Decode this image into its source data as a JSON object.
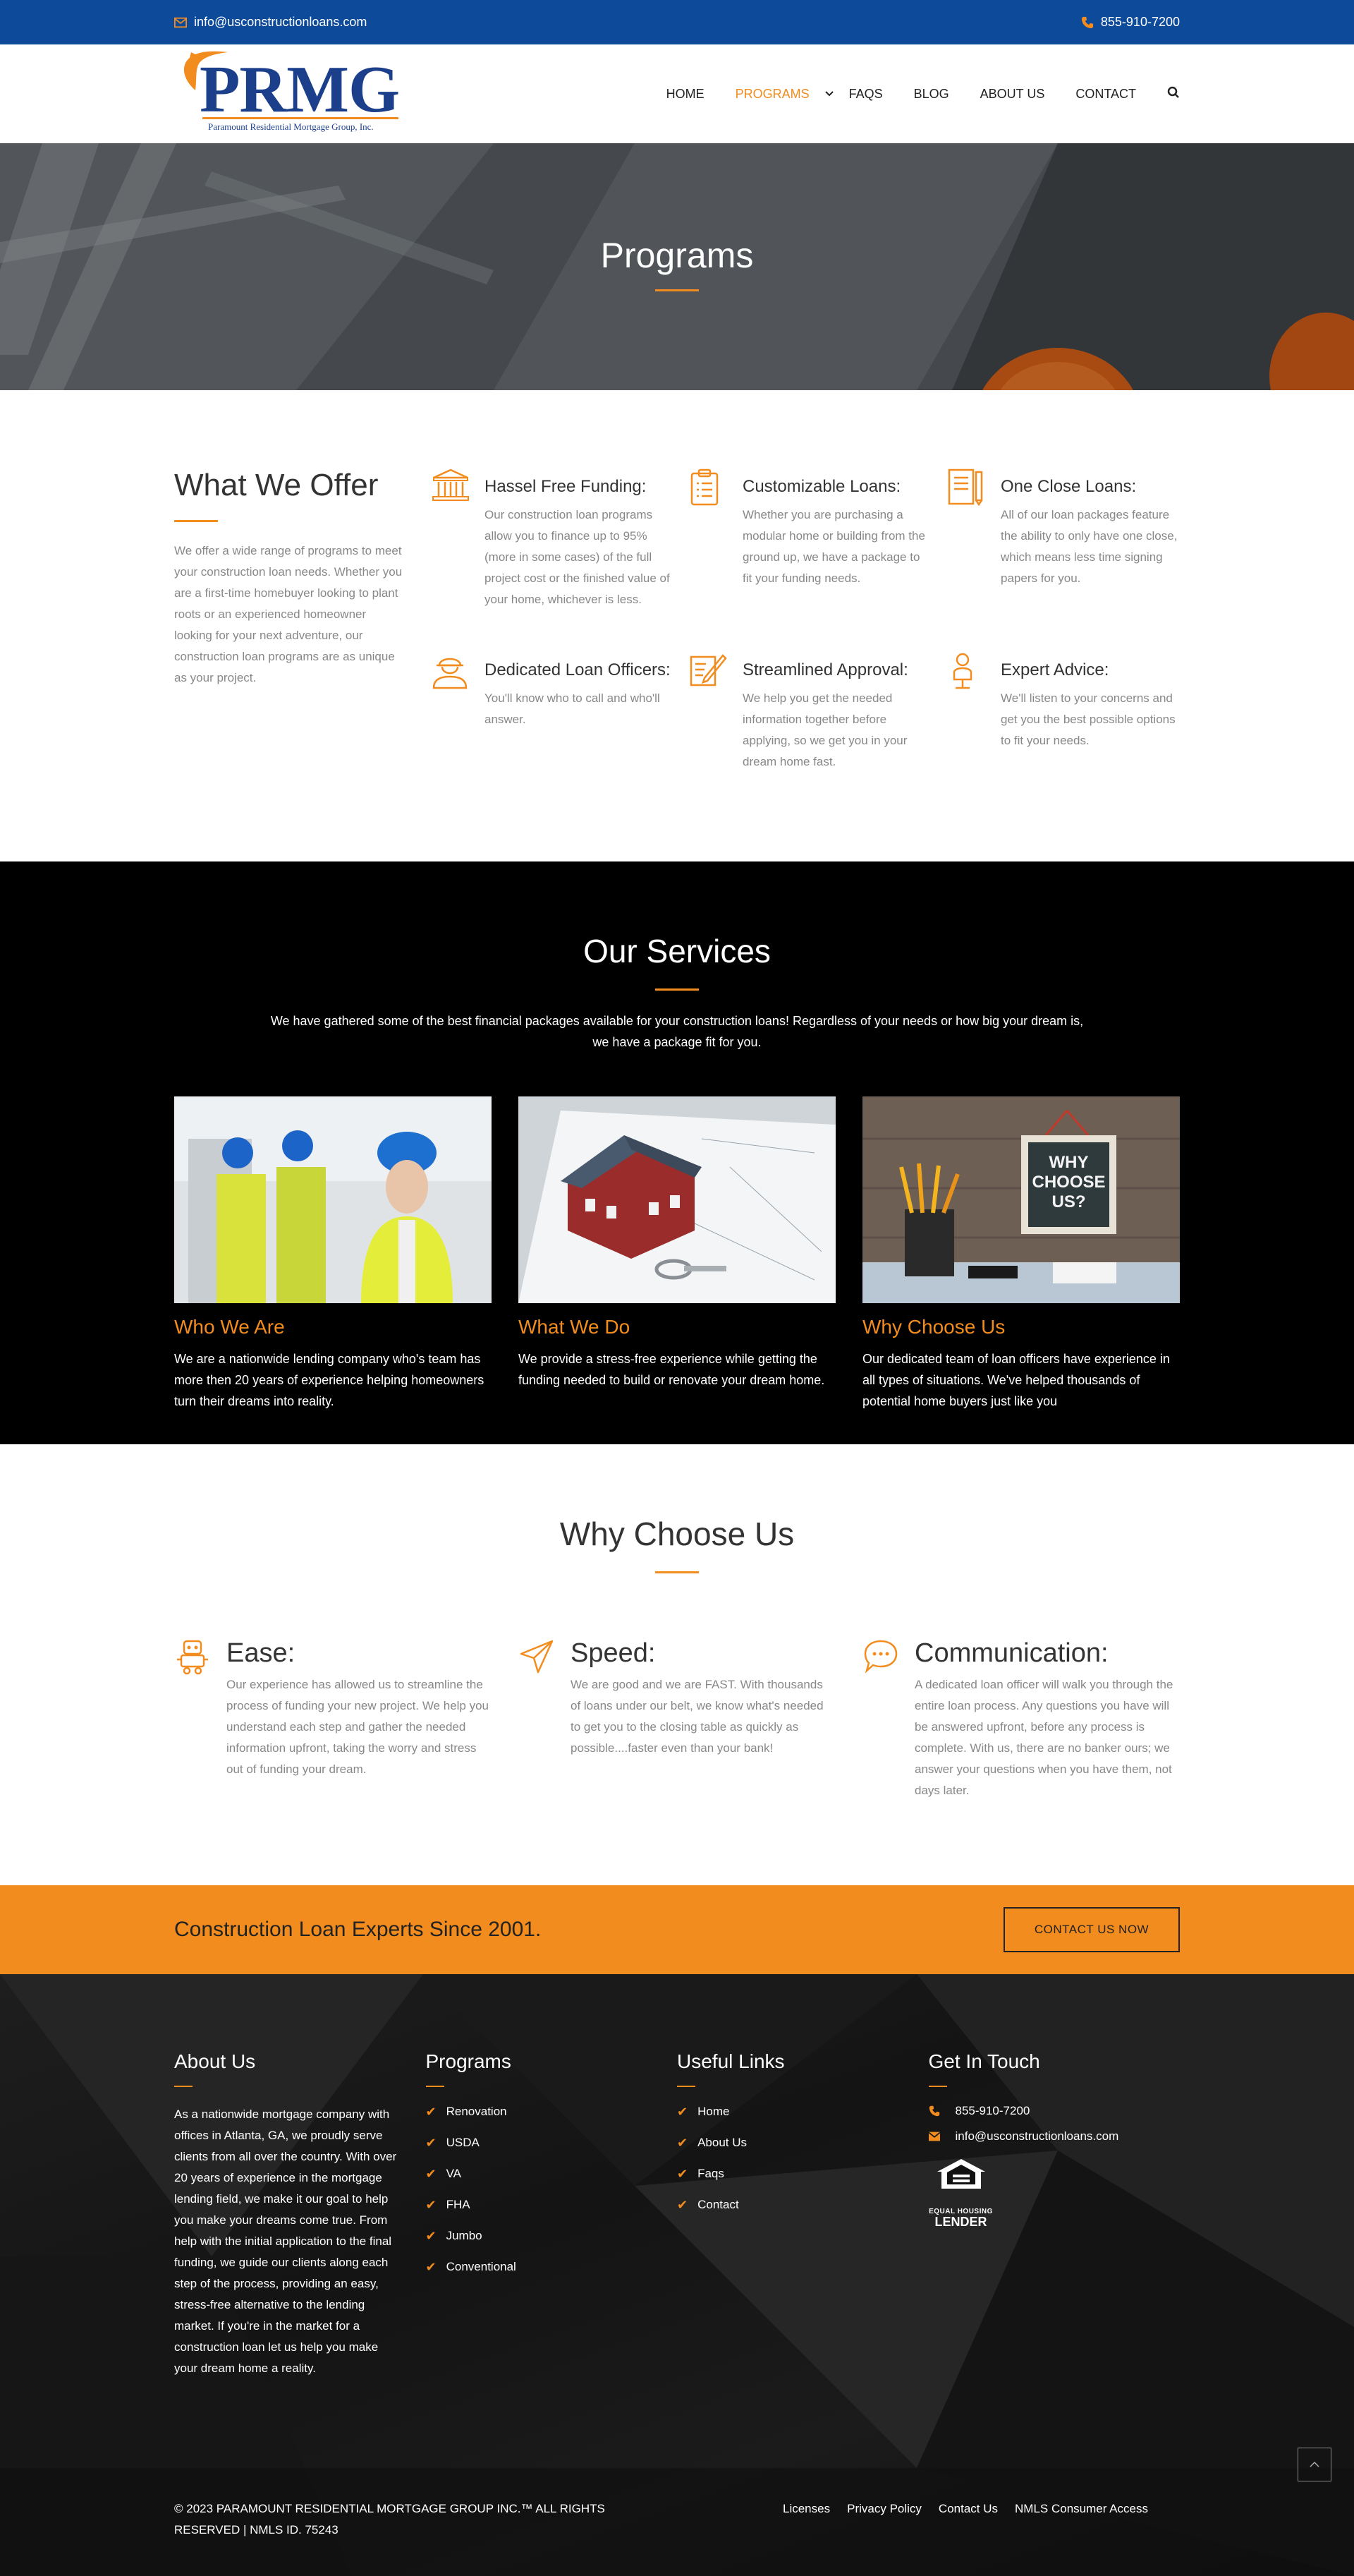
{
  "topbar": {
    "email": "info@usconstructionloans.com",
    "phone": "855-910-7200"
  },
  "logo": {
    "word": "PRMG",
    "subtitle": "Paramount Residential Mortgage Group, Inc."
  },
  "nav": {
    "items": [
      {
        "label": "HOME"
      },
      {
        "label": "PROGRAMS",
        "active": true
      },
      {
        "label": "FAQS"
      },
      {
        "label": "BLOG"
      },
      {
        "label": "ABOUT US"
      },
      {
        "label": "CONTACT"
      }
    ],
    "search_icon": "search-icon"
  },
  "hero": {
    "title": "Programs"
  },
  "offer": {
    "title": "What We Offer",
    "intro": "We offer a wide range of programs to meet your construction loan needs. Whether you are a first-time homebuyer looking to plant roots or an experienced homeowner looking for your next adventure, our construction loan programs are as unique as your project.",
    "features": [
      {
        "icon": "bank-icon",
        "title": "Hassel Free Funding:",
        "text": "Our construction loan programs allow you to finance up to 95% (more in some cases) of the full project cost or the finished value of your home, whichever is less."
      },
      {
        "icon": "clipboard-icon",
        "title": "Customizable Loans:",
        "text": "Whether you are purchasing a modular home or building from the ground up, we have a package to fit your funding needs."
      },
      {
        "icon": "document-icon",
        "title": "One Close Loans:",
        "text": "All of our loan packages feature the ability to only have one close, which means less time signing papers for you."
      },
      {
        "icon": "worker-icon",
        "title": "Dedicated Loan Officers:",
        "text": "You'll know who to call and who'll answer."
      },
      {
        "icon": "pen-paper-icon",
        "title": "Streamlined Approval:",
        "text": "We help you get the needed information together before applying, so we get you in your dream home fast."
      },
      {
        "icon": "advisor-icon",
        "title": "Expert Advice:",
        "text": "We'll listen to your concerns and get you the best possible options to fit your needs."
      }
    ]
  },
  "services": {
    "title": "Our Services",
    "lead": "We have gathered some of the best financial packages available for your construction loans! Regardless of your needs or how big your dream is, we have a package fit for you.",
    "cards": [
      {
        "title": "Who We Are",
        "text": "We are a nationwide lending company who's team has more then 20 years of experience helping homeowners turn their dreams into reality."
      },
      {
        "title": "What We Do",
        "text": "We provide a stress-free experience while getting the funding needed to build or renovate your dream home."
      },
      {
        "title": "Why Choose Us",
        "text": "Our dedicated team of loan officers have experience in all types of situations. We've helped thousands of potential home buyers just like you",
        "chalk": "WHY CHOOSE US?"
      }
    ]
  },
  "why": {
    "title": "Why Choose Us",
    "items": [
      {
        "icon": "robot-icon",
        "title": "Ease:",
        "text": "Our experience has allowed us to streamline the process of funding your new project. We help you understand each step and gather the needed information upfront, taking the worry and stress out of funding your dream."
      },
      {
        "icon": "paper-plane-icon",
        "title": "Speed:",
        "text": "We are good and we are FAST. With thousands of loans under our belt, we know what's needed to get you to the closing table as quickly as possible....faster even than your bank!"
      },
      {
        "icon": "chat-icon",
        "title": "Communication:",
        "text": "A dedicated loan officer will walk you through the entire loan process. Any questions you have will be answered upfront, before any process is complete. With us, there are no banker ours; we answer your questions when you have them, not days later."
      }
    ]
  },
  "cta": {
    "text": "Construction Loan Experts Since 2001.",
    "button": "CONTACT US NOW"
  },
  "footer": {
    "about": {
      "title": "About Us",
      "text": "As a nationwide mortgage company with offices in Atlanta, GA, we proudly serve clients from all over the country. With over 20 years of experience in the mortgage lending field, we make it our goal to help you make your dreams come true. From help with the initial application to the final funding, we guide our clients along each step of the process, providing an easy, stress-free alternative to the lending market. If you're in the market for a construction loan let us help you make your dream home a reality."
    },
    "programs": {
      "title": "Programs",
      "items": [
        "Renovation",
        "USDA",
        "VA",
        "FHA",
        "Jumbo",
        "Conventional"
      ]
    },
    "links": {
      "title": "Useful Links",
      "items": [
        "Home",
        "About Us",
        "Faqs",
        "Contact"
      ]
    },
    "contact": {
      "title": "Get In Touch",
      "phone": "855-910-7200",
      "email": "info@usconstructionloans.com",
      "ehl_line1": "EQUAL HOUSING",
      "ehl_line2": "LENDER"
    },
    "copyright": "©  2023 PARAMOUNT RESIDENTIAL MORTGAGE GROUP INC.™ ALL RIGHTS RESERVED | NMLS ID. 75243",
    "bottom_links": [
      "Licenses",
      "Privacy Policy",
      "Contact Us",
      "NMLS Consumer Access"
    ]
  },
  "colors": {
    "accent": "#f28c1e",
    "topbar": "#0d4a9a",
    "brand": "#1c3f8c"
  }
}
